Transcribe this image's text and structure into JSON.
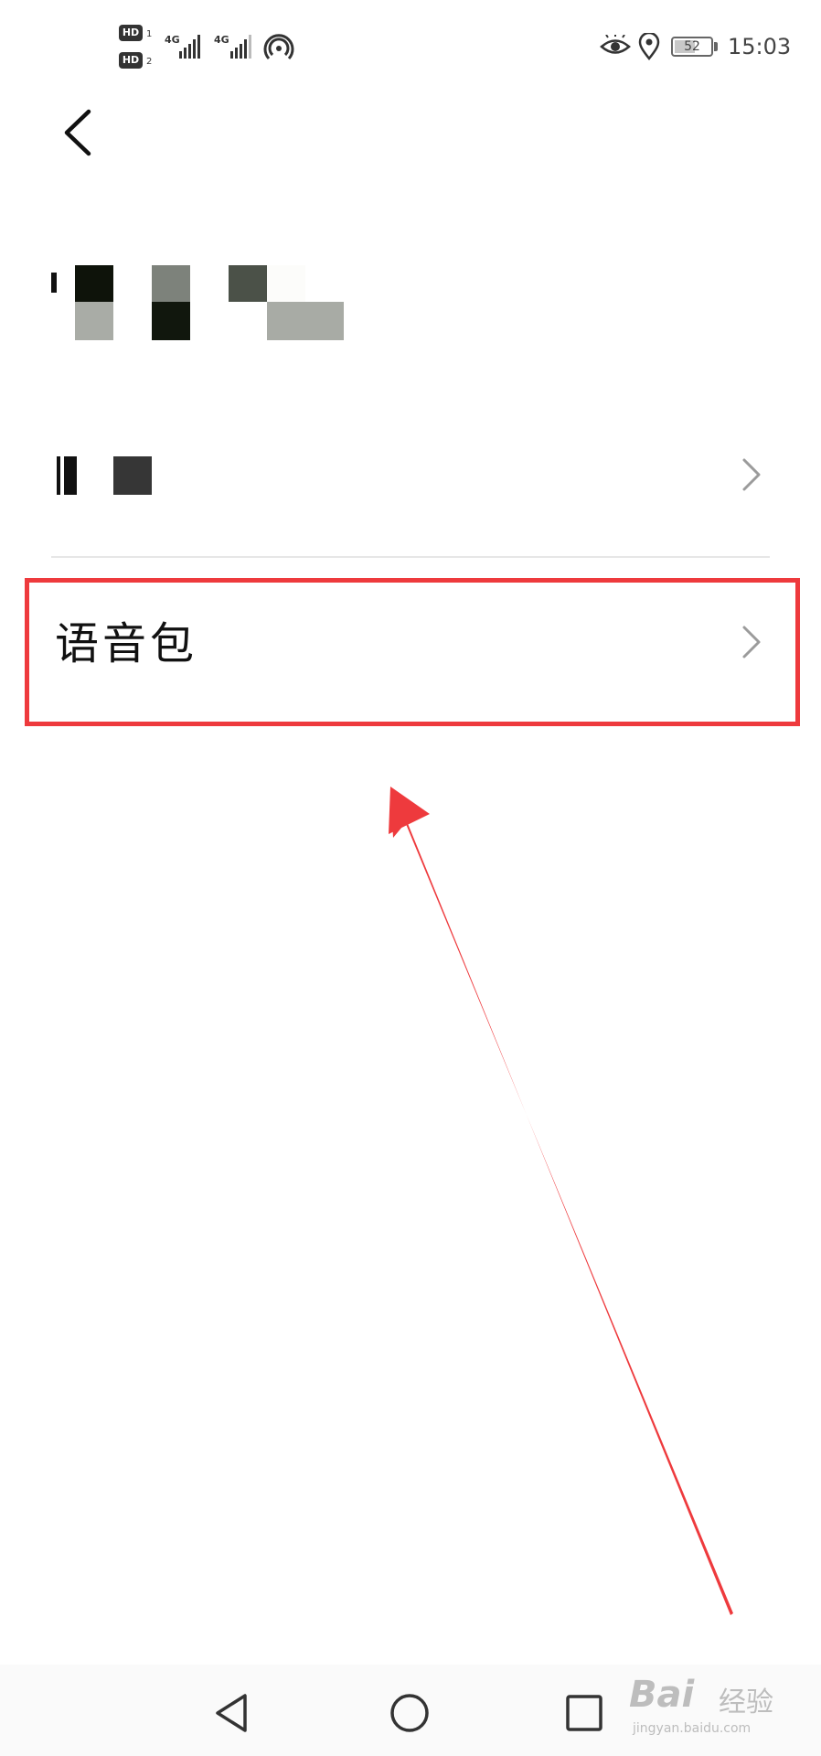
{
  "status_bar": {
    "hd1": "HD",
    "hd1_sub": "1",
    "hd2": "HD",
    "hd2_sub": "2",
    "net1": "4G",
    "net2": "4G",
    "battery_level": "52",
    "time": "15:03",
    "icons": [
      "signal-icon",
      "hotspot-icon",
      "eye-comfort-icon",
      "location-icon",
      "battery-icon"
    ]
  },
  "header": {
    "back_icon": "chevron-left-icon"
  },
  "menu": {
    "items": [
      {
        "label": "",
        "icon": "chevron-right-icon"
      },
      {
        "label": "语音包",
        "icon": "chevron-right-icon"
      }
    ]
  },
  "annotation": {
    "box_color": "#ee3a3d",
    "arrow_color": "#ee3a3d"
  },
  "nav_bar": {
    "icons": [
      "nav-back-icon",
      "nav-home-icon",
      "nav-recent-icon"
    ]
  },
  "watermark": {
    "brand": "Bai",
    "text": "经验",
    "url": "jingyan.baidu.com"
  }
}
